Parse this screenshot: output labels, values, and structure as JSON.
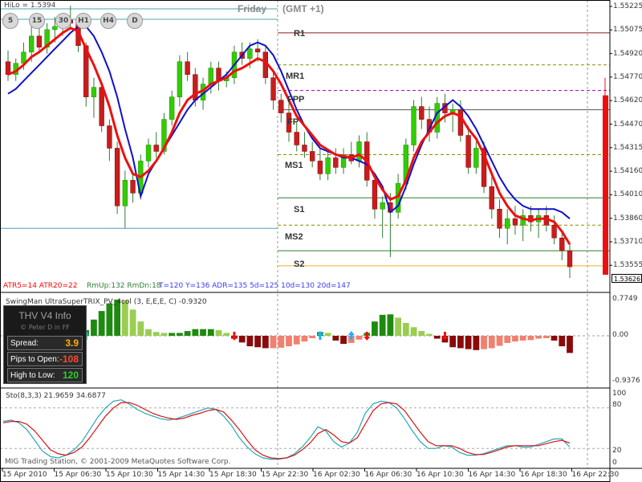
{
  "hilo_label": "HiLo = 1.5394",
  "timeframe_buttons": [
    "5",
    "15",
    "30",
    "H1",
    "H4",
    "D"
  ],
  "day_label": "Friday",
  "gmt_label": "(GMT +1)",
  "levels": [
    {
      "name": "R1",
      "price": 1.5508,
      "color": "#8b1a1a",
      "style": "solid"
    },
    {
      "name": "MR1",
      "price": 1.5488,
      "color": "#8b8b00",
      "style": "dashed"
    },
    {
      "name": "FPP",
      "price": 1.5472,
      "color": "#a000a0",
      "style": "dashed"
    },
    {
      "name": "FP",
      "price": 1.546,
      "color": "#555555",
      "style": "solid"
    },
    {
      "name": "MS1",
      "price": 1.5432,
      "color": "#8b8b00",
      "style": "dashed"
    },
    {
      "name": "S1",
      "price": 1.5405,
      "color": "#2e7d32",
      "style": "solid"
    },
    {
      "name": "MS2",
      "price": 1.5388,
      "color": "#8b8b00",
      "style": "dashed"
    },
    {
      "name": "S2",
      "price": 1.5372,
      "color": "#2e7d32",
      "style": "solid"
    }
  ],
  "hilo_lines": [
    {
      "price": 1.5523,
      "color": "#4aa3b5"
    },
    {
      "price": 1.5386,
      "color": "#4aa3b5"
    }
  ],
  "price_axis": [
    "1.55225",
    "1.55075",
    "1.54920",
    "1.54770",
    "1.54620",
    "1.54470",
    "1.54315",
    "1.54160",
    "1.54010",
    "1.53860",
    "1.53710",
    "1.53555"
  ],
  "current_price": "1.53626",
  "status_line": {
    "atr": "ATR5=14 ATR20=22",
    "rm": "RmUp:132 RmDn:18",
    "stats": "T=120  Y=136  ADR=135  5d=125  10d=130  20d=147"
  },
  "trix": {
    "title": "SwingMan UltraSuperTRIX_PV_4col (3, E,E,E, C) -0.9320",
    "axis": [
      "0.7749",
      "0.00",
      "-0.9376"
    ],
    "values": [
      0.3,
      -0.4,
      -0.62,
      -0.78,
      -0.88,
      -0.93,
      -0.86,
      -0.66,
      -0.4,
      -0.1,
      0.12,
      0.34,
      0.52,
      0.68,
      0.76,
      0.74,
      0.55,
      0.3,
      0.14,
      0.08,
      0.06,
      0.06,
      0.06,
      0.1,
      0.14,
      0.14,
      0.14,
      0.12,
      0.06,
      -0.06,
      -0.14,
      -0.22,
      -0.24,
      -0.26,
      -0.26,
      -0.25,
      -0.22,
      -0.18,
      -0.12,
      -0.05,
      0.08,
      0.06,
      -0.1,
      -0.17,
      -0.15,
      -0.08,
      0.06,
      0.3,
      0.44,
      0.45,
      0.38,
      0.27,
      0.18,
      0.1,
      0.04,
      -0.06,
      -0.14,
      -0.24,
      -0.26,
      -0.28,
      -0.3,
      -0.28,
      -0.26,
      -0.21,
      -0.15,
      -0.12,
      -0.1,
      -0.09,
      -0.06,
      -0.05,
      -0.1,
      -0.22,
      -0.36
    ]
  },
  "up_arrow_index": [
    10,
    40,
    44
  ],
  "down_arrow_index": [
    29,
    46,
    56
  ],
  "info_panel": {
    "title": "THV  V4  Info",
    "subtitle": "© Peter D in FF",
    "rows": [
      {
        "label": "Spread:",
        "value": "3.9",
        "color": "#ffb000"
      },
      {
        "label": "Pips to Open:",
        "value": "-108",
        "color": "#ff4a2a"
      },
      {
        "label": "High to Low:",
        "value": "120",
        "color": "#2bd02b"
      }
    ]
  },
  "stoch": {
    "title": "Sto(8,3,3) 21.9659 34.6877",
    "axis": [
      "100",
      "80",
      "20",
      "0"
    ],
    "main": [
      60,
      62,
      58,
      48,
      32,
      16,
      8,
      6,
      10,
      18,
      30,
      48,
      66,
      80,
      90,
      92,
      86,
      78,
      72,
      68,
      64,
      62,
      64,
      68,
      72,
      76,
      80,
      78,
      68,
      54,
      36,
      22,
      12,
      6,
      4,
      4,
      6,
      12,
      22,
      36,
      52,
      46,
      30,
      22,
      28,
      44,
      72,
      86,
      90,
      88,
      80,
      64,
      46,
      30,
      20,
      20,
      24,
      22,
      14,
      10,
      10,
      12,
      16,
      20,
      24,
      24,
      22,
      22,
      26,
      30,
      34,
      34,
      22
    ],
    "signal": [
      58,
      60,
      60,
      56,
      46,
      32,
      18,
      12,
      10,
      14,
      22,
      36,
      52,
      68,
      80,
      88,
      88,
      84,
      78,
      72,
      68,
      65,
      63,
      65,
      69,
      72,
      76,
      78,
      74,
      62,
      48,
      32,
      18,
      10,
      6,
      5,
      6,
      10,
      18,
      28,
      42,
      48,
      40,
      30,
      28,
      36,
      56,
      76,
      86,
      88,
      86,
      76,
      60,
      44,
      30,
      24,
      24,
      24,
      20,
      14,
      11,
      11,
      14,
      18,
      22,
      24,
      24,
      24,
      24,
      27,
      30,
      32,
      28
    ]
  },
  "copyright": "MIG Trading Station, © 2001-2009 MetaQuotes Software Corp.",
  "time_axis": [
    "15 Apr 2010",
    "15 Apr 06:30",
    "15 Apr 10:30",
    "15 Apr 14:30",
    "15 Apr 18:30",
    "15 Apr 22:30",
    "16 Apr 02:30",
    "16 Apr 06:30",
    "16 Apr 10:30",
    "16 Apr 14:30",
    "16 Apr 18:30",
    "16 Apr 22:30"
  ],
  "candles": [
    {
      "o": 1.549,
      "h": 1.5497,
      "l": 1.5478,
      "c": 1.5482
    },
    {
      "o": 1.5482,
      "h": 1.5492,
      "l": 1.5478,
      "c": 1.5489
    },
    {
      "o": 1.5489,
      "h": 1.5502,
      "l": 1.5485,
      "c": 1.5496
    },
    {
      "o": 1.5496,
      "h": 1.5512,
      "l": 1.549,
      "c": 1.5506
    },
    {
      "o": 1.5506,
      "h": 1.5515,
      "l": 1.5497,
      "c": 1.5499
    },
    {
      "o": 1.5499,
      "h": 1.5514,
      "l": 1.5495,
      "c": 1.551
    },
    {
      "o": 1.551,
      "h": 1.5518,
      "l": 1.5502,
      "c": 1.5512
    },
    {
      "o": 1.5512,
      "h": 1.5519,
      "l": 1.5506,
      "c": 1.5516
    },
    {
      "o": 1.5516,
      "h": 1.5525,
      "l": 1.551,
      "c": 1.5514
    },
    {
      "o": 1.5514,
      "h": 1.5516,
      "l": 1.5496,
      "c": 1.55
    },
    {
      "o": 1.55,
      "h": 1.5502,
      "l": 1.5462,
      "c": 1.5468
    },
    {
      "o": 1.5468,
      "h": 1.548,
      "l": 1.5455,
      "c": 1.5474
    },
    {
      "o": 1.5474,
      "h": 1.5478,
      "l": 1.5446,
      "c": 1.545
    },
    {
      "o": 1.545,
      "h": 1.5454,
      "l": 1.5428,
      "c": 1.5436
    },
    {
      "o": 1.5436,
      "h": 1.544,
      "l": 1.5395,
      "c": 1.54
    },
    {
      "o": 1.54,
      "h": 1.5422,
      "l": 1.5386,
      "c": 1.5416
    },
    {
      "o": 1.5416,
      "h": 1.542,
      "l": 1.5402,
      "c": 1.5408
    },
    {
      "o": 1.5408,
      "h": 1.5432,
      "l": 1.5404,
      "c": 1.5428
    },
    {
      "o": 1.5428,
      "h": 1.5442,
      "l": 1.5424,
      "c": 1.5438
    },
    {
      "o": 1.5438,
      "h": 1.5446,
      "l": 1.543,
      "c": 1.5434
    },
    {
      "o": 1.5434,
      "h": 1.5458,
      "l": 1.5432,
      "c": 1.5454
    },
    {
      "o": 1.5454,
      "h": 1.5472,
      "l": 1.545,
      "c": 1.5468
    },
    {
      "o": 1.5468,
      "h": 1.5494,
      "l": 1.5462,
      "c": 1.549
    },
    {
      "o": 1.549,
      "h": 1.5496,
      "l": 1.5478,
      "c": 1.5482
    },
    {
      "o": 1.5482,
      "h": 1.5486,
      "l": 1.5462,
      "c": 1.5466
    },
    {
      "o": 1.5466,
      "h": 1.548,
      "l": 1.546,
      "c": 1.5476
    },
    {
      "o": 1.5476,
      "h": 1.549,
      "l": 1.547,
      "c": 1.5486
    },
    {
      "o": 1.5486,
      "h": 1.549,
      "l": 1.5472,
      "c": 1.5478
    },
    {
      "o": 1.5478,
      "h": 1.5484,
      "l": 1.5474,
      "c": 1.548
    },
    {
      "o": 1.548,
      "h": 1.55,
      "l": 1.5476,
      "c": 1.5496
    },
    {
      "o": 1.5496,
      "h": 1.5502,
      "l": 1.5488,
      "c": 1.5492
    },
    {
      "o": 1.5492,
      "h": 1.5502,
      "l": 1.5486,
      "c": 1.5498
    },
    {
      "o": 1.5498,
      "h": 1.5504,
      "l": 1.549,
      "c": 1.5496
    },
    {
      "o": 1.5496,
      "h": 1.55,
      "l": 1.5476,
      "c": 1.548
    },
    {
      "o": 1.548,
      "h": 1.5484,
      "l": 1.546,
      "c": 1.5466
    },
    {
      "o": 1.5466,
      "h": 1.547,
      "l": 1.5452,
      "c": 1.5458
    },
    {
      "o": 1.5458,
      "h": 1.5466,
      "l": 1.544,
      "c": 1.5446
    },
    {
      "o": 1.5446,
      "h": 1.5452,
      "l": 1.5434,
      "c": 1.5438
    },
    {
      "o": 1.5438,
      "h": 1.5446,
      "l": 1.543,
      "c": 1.5434
    },
    {
      "o": 1.5434,
      "h": 1.544,
      "l": 1.5424,
      "c": 1.5428
    },
    {
      "o": 1.5428,
      "h": 1.5436,
      "l": 1.5416,
      "c": 1.542
    },
    {
      "o": 1.542,
      "h": 1.5434,
      "l": 1.5416,
      "c": 1.543
    },
    {
      "o": 1.543,
      "h": 1.5436,
      "l": 1.542,
      "c": 1.5424
    },
    {
      "o": 1.5424,
      "h": 1.5436,
      "l": 1.542,
      "c": 1.5432
    },
    {
      "o": 1.5432,
      "h": 1.544,
      "l": 1.5426,
      "c": 1.5428
    },
    {
      "o": 1.5428,
      "h": 1.5444,
      "l": 1.5424,
      "c": 1.544
    },
    {
      "o": 1.544,
      "h": 1.5446,
      "l": 1.5412,
      "c": 1.5416
    },
    {
      "o": 1.5416,
      "h": 1.542,
      "l": 1.5392,
      "c": 1.5398
    },
    {
      "o": 1.5398,
      "h": 1.5406,
      "l": 1.538,
      "c": 1.5402
    },
    {
      "o": 1.5402,
      "h": 1.5408,
      "l": 1.5368,
      "c": 1.5396
    },
    {
      "o": 1.5396,
      "h": 1.542,
      "l": 1.5392,
      "c": 1.5414
    },
    {
      "o": 1.5414,
      "h": 1.5442,
      "l": 1.541,
      "c": 1.5438
    },
    {
      "o": 1.5438,
      "h": 1.5466,
      "l": 1.5434,
      "c": 1.5462
    },
    {
      "o": 1.5462,
      "h": 1.5468,
      "l": 1.5448,
      "c": 1.5454
    },
    {
      "o": 1.5454,
      "h": 1.5462,
      "l": 1.544,
      "c": 1.5446
    },
    {
      "o": 1.5446,
      "h": 1.5468,
      "l": 1.5442,
      "c": 1.5464
    },
    {
      "o": 1.5464,
      "h": 1.547,
      "l": 1.5452,
      "c": 1.5458
    },
    {
      "o": 1.5458,
      "h": 1.5464,
      "l": 1.5446,
      "c": 1.546
    },
    {
      "o": 1.546,
      "h": 1.5466,
      "l": 1.544,
      "c": 1.5444
    },
    {
      "o": 1.5444,
      "h": 1.545,
      "l": 1.542,
      "c": 1.5424
    },
    {
      "o": 1.5424,
      "h": 1.544,
      "l": 1.542,
      "c": 1.5436
    },
    {
      "o": 1.5436,
      "h": 1.544,
      "l": 1.5408,
      "c": 1.5412
    },
    {
      "o": 1.5412,
      "h": 1.5418,
      "l": 1.5392,
      "c": 1.5398
    },
    {
      "o": 1.5398,
      "h": 1.5404,
      "l": 1.538,
      "c": 1.5386
    },
    {
      "o": 1.5386,
      "h": 1.5398,
      "l": 1.5376,
      "c": 1.5392
    },
    {
      "o": 1.5392,
      "h": 1.54,
      "l": 1.5382,
      "c": 1.5388
    },
    {
      "o": 1.5388,
      "h": 1.5398,
      "l": 1.5378,
      "c": 1.5394
    },
    {
      "o": 1.5394,
      "h": 1.54,
      "l": 1.5384,
      "c": 1.539
    },
    {
      "o": 1.539,
      "h": 1.5398,
      "l": 1.538,
      "c": 1.5394
    },
    {
      "o": 1.5394,
      "h": 1.54,
      "l": 1.5384,
      "c": 1.5388
    },
    {
      "o": 1.5388,
      "h": 1.5394,
      "l": 1.5376,
      "c": 1.538
    },
    {
      "o": 1.538,
      "h": 1.5384,
      "l": 1.5366,
      "c": 1.5372
    },
    {
      "o": 1.5372,
      "h": 1.5376,
      "l": 1.5355,
      "c": 1.5362
    }
  ],
  "red_ma": [
    1.5482,
    1.5484,
    1.5488,
    1.5493,
    1.5496,
    1.55,
    1.5504,
    1.5508,
    1.5511,
    1.5509,
    1.5498,
    1.5488,
    1.5476,
    1.5462,
    1.5444,
    1.543,
    1.542,
    1.5418,
    1.5422,
    1.5428,
    1.5436,
    1.5446,
    1.5458,
    1.5466,
    1.547,
    1.5472,
    1.5476,
    1.5478,
    1.548,
    1.5484,
    1.5486,
    1.5489,
    1.5492,
    1.549,
    1.5484,
    1.5476,
    1.5466,
    1.5456,
    1.545,
    1.5444,
    1.5438,
    1.5435,
    1.5432,
    1.5431,
    1.543,
    1.5432,
    1.5428,
    1.5418,
    1.541,
    1.5404,
    1.5406,
    1.5416,
    1.543,
    1.544,
    1.5446,
    1.5452,
    1.5456,
    1.5458,
    1.5456,
    1.5448,
    1.5442,
    1.5432,
    1.542,
    1.5408,
    1.54,
    1.5394,
    1.5392,
    1.5391,
    1.5392,
    1.5392,
    1.539,
    1.5384,
    1.5376
  ],
  "blue_ma": [
    1.547,
    1.5473,
    1.5478,
    1.5483,
    1.5488,
    1.5493,
    1.5498,
    1.5503,
    1.5508,
    1.5512,
    1.5512,
    1.5506,
    1.5496,
    1.5484,
    1.5468,
    1.5448,
    1.543,
    1.5406,
    1.542,
    1.5428,
    1.5436,
    1.5444,
    1.5452,
    1.546,
    1.5466,
    1.547,
    1.5474,
    1.5478,
    1.5482,
    1.5488,
    1.5494,
    1.55,
    1.5502,
    1.55,
    1.5494,
    1.5484,
    1.5472,
    1.546,
    1.545,
    1.5442,
    1.5436,
    1.5434,
    1.5432,
    1.543,
    1.543,
    1.5428,
    1.5426,
    1.542,
    1.5412,
    1.5396,
    1.54,
    1.5412,
    1.5426,
    1.5438,
    1.5448,
    1.5458,
    1.5462,
    1.5466,
    1.5462,
    1.5456,
    1.5448,
    1.5438,
    1.5428,
    1.5418,
    1.541,
    1.5404,
    1.54,
    1.5398,
    1.5398,
    1.5398,
    1.5398,
    1.5396,
    1.5392
  ]
}
